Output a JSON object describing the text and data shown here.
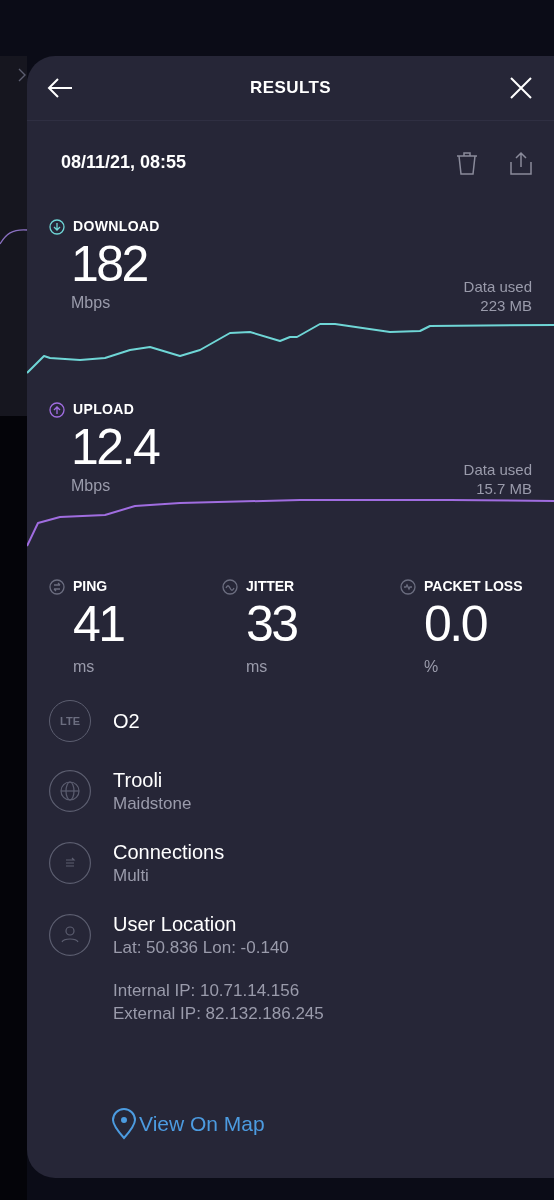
{
  "header": {
    "title": "RESULTS"
  },
  "test": {
    "datetime": "08/11/21, 08:55"
  },
  "speeds": [
    {
      "kind": "download",
      "label": "DOWNLOAD",
      "value": "182",
      "unit": "Mbps",
      "data_label": "Data used",
      "data_value": "223 MB",
      "color": "#6fd6d6"
    },
    {
      "kind": "upload",
      "label": "UPLOAD",
      "value": "12.4",
      "unit": "Mbps",
      "data_label": "Data used",
      "data_value": "15.7 MB",
      "color": "#a06de0"
    }
  ],
  "metrics": [
    {
      "kind": "ping",
      "label": "PING",
      "value": "41",
      "unit": "ms"
    },
    {
      "kind": "jitter",
      "label": "JITTER",
      "value": "33",
      "unit": "ms"
    },
    {
      "kind": "packet_loss",
      "label": "PACKET LOSS",
      "value": "0.0",
      "unit": "%"
    }
  ],
  "details": [
    {
      "kind": "lte",
      "icon_text": "LTE",
      "title": "O2"
    },
    {
      "kind": "globe",
      "title": "Trooli",
      "subtitle": "Maidstone"
    },
    {
      "kind": "connections",
      "title": "Connections",
      "subtitle": "Multi"
    },
    {
      "kind": "user",
      "title": "User Location",
      "subtitle": "Lat: 50.836 Lon: -0.140"
    }
  ],
  "ip_lines": [
    "Internal IP: 10.71.14.156",
    "External IP: 82.132.186.245"
  ],
  "map_link": "View On Map"
}
